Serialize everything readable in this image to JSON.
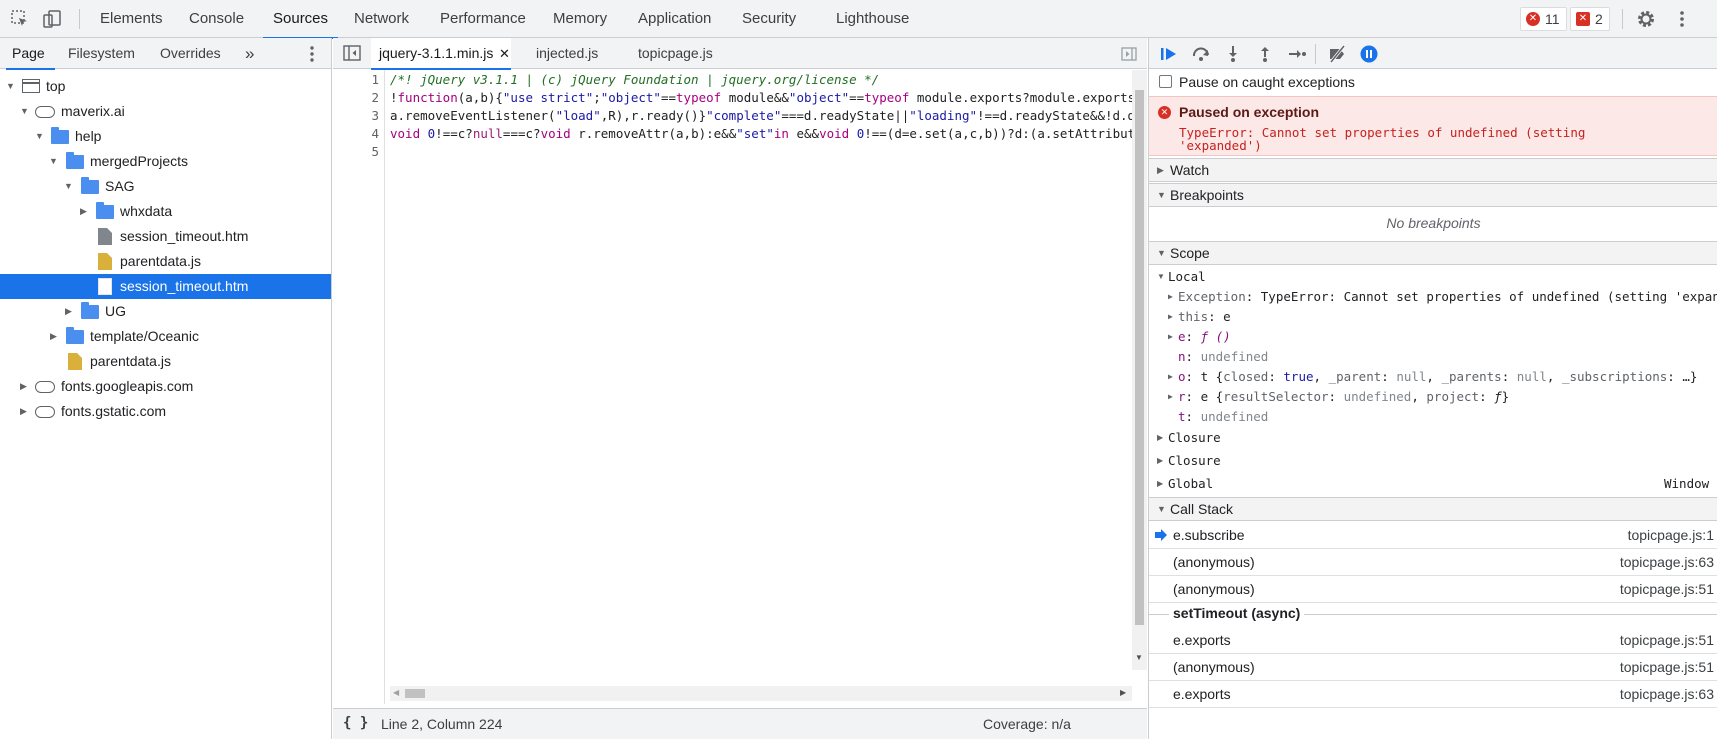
{
  "main_tabs": [
    "Elements",
    "Console",
    "Sources",
    "Network",
    "Performance",
    "Memory",
    "Application",
    "Security",
    "Lighthouse"
  ],
  "active_main_tab": "Sources",
  "badges": {
    "errors": "11",
    "issues": "2"
  },
  "navigator": {
    "tabs": [
      "Page",
      "Filesystem",
      "Overrides"
    ],
    "more": "»",
    "tree": [
      {
        "label": "top",
        "icon": "frame-icon"
      },
      {
        "label": "maverix.ai",
        "icon": "cloud-icon"
      },
      {
        "label": "help",
        "icon": "folder-icon"
      },
      {
        "label": "mergedProjects",
        "icon": "folder-icon"
      },
      {
        "label": "SAG",
        "icon": "folder-icon"
      },
      {
        "label": "whxdata",
        "icon": "folder-icon"
      },
      {
        "label": "session_timeout.htm",
        "icon": "file-icon"
      },
      {
        "label": "parentdata.js",
        "icon": "js-file-icon"
      },
      {
        "label": "session_timeout.htm",
        "icon": "file-icon",
        "selected": true
      },
      {
        "label": "UG",
        "icon": "folder-icon"
      },
      {
        "label": "template/Oceanic",
        "icon": "folder-icon"
      },
      {
        "label": "parentdata.js",
        "icon": "js-file-icon"
      },
      {
        "label": "fonts.googleapis.com",
        "icon": "cloud-icon"
      },
      {
        "label": "fonts.gstatic.com",
        "icon": "cloud-icon"
      }
    ]
  },
  "editor": {
    "tabs": [
      "jquery-3.1.1.min.js",
      "injected.js",
      "topicpage.js"
    ],
    "active_tab": "jquery-3.1.1.min.js",
    "close_glyph": "✕",
    "line_numbers": [
      "1",
      "2",
      "3",
      "4",
      "5"
    ],
    "status": {
      "format": "{ }",
      "position": "Line 2, Column 224",
      "coverage": "Coverage: n/a"
    }
  },
  "debugger": {
    "pause_on_caught": "Pause on caught exceptions",
    "paused_title": "Paused on exception",
    "paused_message_1": "TypeError: Cannot set properties of undefined (setting",
    "paused_message_2": "'expanded')",
    "sections": {
      "watch": "Watch",
      "breakpoints": "Breakpoints",
      "scope": "Scope",
      "callstack": "Call Stack"
    },
    "no_breakpoints": "No breakpoints",
    "scope": {
      "local_label": "Local",
      "closure_1": "Closure",
      "closure_2": "Closure",
      "global": "Global",
      "global_value": "Window"
    },
    "call_stack": [
      {
        "fn": "e.subscribe",
        "loc": "topicpage.js:1",
        "current": true
      },
      {
        "fn": "(anonymous)",
        "loc": "topicpage.js:63"
      },
      {
        "fn": "(anonymous)",
        "loc": "topicpage.js:51"
      },
      {
        "async": "setTimeout (async)"
      },
      {
        "fn": "e.exports",
        "loc": "topicpage.js:51"
      },
      {
        "fn": "(anonymous)",
        "loc": "topicpage.js:51"
      },
      {
        "fn": "e.exports",
        "loc": "topicpage.js:63"
      }
    ]
  },
  "colors": {
    "accent": "#1a73e8",
    "error": "#d93025",
    "paused_bg": "#fce8e6"
  }
}
